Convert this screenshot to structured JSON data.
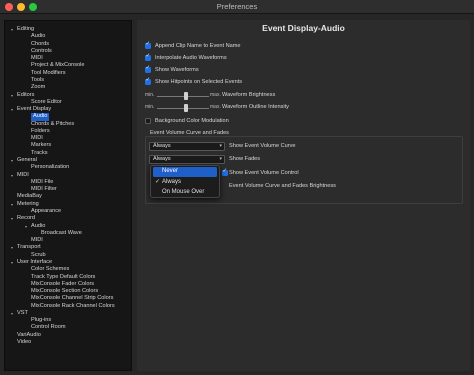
{
  "window": {
    "title": "Preferences"
  },
  "sidebar": {
    "items": [
      {
        "label": "Editing",
        "indent": 0
      },
      {
        "label": "Audio",
        "indent": 1
      },
      {
        "label": "Chords",
        "indent": 1
      },
      {
        "label": "Controls",
        "indent": 1
      },
      {
        "label": "MIDI",
        "indent": 1
      },
      {
        "label": "Project & MixConsole",
        "indent": 1
      },
      {
        "label": "Tool Modifiers",
        "indent": 1
      },
      {
        "label": "Tools",
        "indent": 1
      },
      {
        "label": "Zoom",
        "indent": 1
      },
      {
        "label": "Editors",
        "indent": 0
      },
      {
        "label": "Score Editor",
        "indent": 1
      },
      {
        "label": "Event Display",
        "indent": 0
      },
      {
        "label": "Audio",
        "indent": 1,
        "selected": true
      },
      {
        "label": "Chords & Pitches",
        "indent": 1
      },
      {
        "label": "Folders",
        "indent": 1
      },
      {
        "label": "MIDI",
        "indent": 1
      },
      {
        "label": "Markers",
        "indent": 1
      },
      {
        "label": "Tracks",
        "indent": 1
      },
      {
        "label": "General",
        "indent": 0
      },
      {
        "label": "Personalization",
        "indent": 1
      },
      {
        "label": "MIDI",
        "indent": 0
      },
      {
        "label": "MIDI File",
        "indent": 1
      },
      {
        "label": "MIDI Filter",
        "indent": 1
      },
      {
        "label": "MediaBay",
        "indent": 0
      },
      {
        "label": "Metering",
        "indent": 0
      },
      {
        "label": "Appearance",
        "indent": 1
      },
      {
        "label": "Record",
        "indent": 0
      },
      {
        "label": "Audio",
        "indent": 1
      },
      {
        "label": "Broadcast Wave",
        "indent": 2
      },
      {
        "label": "MIDI",
        "indent": 1
      },
      {
        "label": "Transport",
        "indent": 0
      },
      {
        "label": "Scrub",
        "indent": 1
      },
      {
        "label": "User Interface",
        "indent": 0
      },
      {
        "label": "Color Schemes",
        "indent": 1
      },
      {
        "label": "Track Type Default Colors",
        "indent": 1
      },
      {
        "label": "MixConsole Fader Colors",
        "indent": 1
      },
      {
        "label": "MixConsole Section Colors",
        "indent": 1
      },
      {
        "label": "MixConsole Channel Strip Colors",
        "indent": 1
      },
      {
        "label": "MixConsole Rack Channel Colors",
        "indent": 1
      },
      {
        "label": "VST",
        "indent": 0
      },
      {
        "label": "Plug-ins",
        "indent": 1
      },
      {
        "label": "Control Room",
        "indent": 1
      },
      {
        "label": "VariAudio",
        "indent": 0
      },
      {
        "label": "Video",
        "indent": 0
      }
    ]
  },
  "panel": {
    "title": "Event Display-Audio",
    "options": [
      {
        "label": "Append Clip Name to Event Name",
        "checked": true
      },
      {
        "label": "Interpolate Audio Waveforms",
        "checked": true
      },
      {
        "label": "Show Waveforms",
        "checked": true
      },
      {
        "label": "Show Hitpoints on Selected Events",
        "checked": true
      }
    ],
    "sliders": [
      {
        "min_label": "min.",
        "max_label": "max.",
        "label": "Waveform Brightness",
        "value": 0.55
      },
      {
        "min_label": "min.",
        "max_label": "max.",
        "label": "Waveform Outline Intensity",
        "value": 0.55
      }
    ],
    "background_mod": {
      "label": "Background Color Modulation",
      "checked": false
    },
    "group": {
      "title": "Event Volume Curve and Fades",
      "select1": {
        "value": "Always",
        "label": "Show Event Volume Curve"
      },
      "select2": {
        "value": "Always",
        "label": "Show Fades"
      },
      "control_label": "Show Event Volume Control",
      "brightness_label": "Event Volume Curve and Fades Brightness"
    },
    "dropdown": {
      "options": [
        "Never",
        "Always",
        "On Mouse Over"
      ],
      "highlighted": "Never",
      "checked": "Always"
    }
  },
  "colors": {
    "accent": "#1f5fc9",
    "checkbox": "#1f6fe5"
  }
}
